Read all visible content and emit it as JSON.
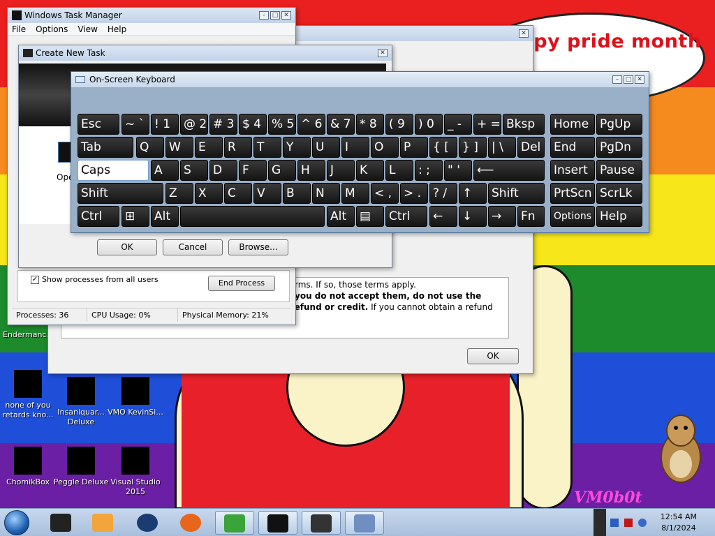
{
  "desktop": {
    "speech_text": "happy pride month",
    "watermark": "VM0b0t",
    "side_label_1": "Endermanc...",
    "icons": [
      {
        "label": "none of you retards kno..."
      },
      {
        "label": "Insaniquar... Deluxe"
      },
      {
        "label": "VMO KevinSi..."
      },
      {
        "label": "ChomikBox"
      },
      {
        "label": "Peggle Deluxe"
      },
      {
        "label": "Visual Studio 2015"
      }
    ]
  },
  "task_manager": {
    "title": "Windows Task Manager",
    "menu": [
      "File",
      "Options",
      "View",
      "Help"
    ],
    "show_all_label": "Show processes from all users",
    "end_process": "End Process",
    "status": {
      "processes": "Processes: 36",
      "cpu": "CPU Usage: 0%",
      "memory": "Physical Memory: 21%"
    }
  },
  "license_window": {
    "text_line1": "rms. If so, those terms apply.",
    "text_line2_bold": "you do not accept them, do not use the",
    "text_line3_bold": "software. Instead, return it to the retailer for a refund or credit.",
    "text_line3_tail": " If you cannot obtain a refund there,",
    "ok": "OK"
  },
  "create_task": {
    "title": "Create New Task",
    "open_label": "Ope",
    "ok": "OK",
    "cancel": "Cancel",
    "browse": "Browse..."
  },
  "osk": {
    "title": "On-Screen Keyboard",
    "rows": [
      [
        "Esc",
        "~ `",
        "! 1",
        "@ 2",
        "# 3",
        "$ 4",
        "% 5",
        "^ 6",
        "& 7",
        "* 8",
        "( 9",
        ") 0",
        "_ -",
        "+ =",
        "Bksp",
        "Home",
        "PgUp"
      ],
      [
        "Tab",
        "Q",
        "W",
        "E",
        "R",
        "T",
        "Y",
        "U",
        "I",
        "O",
        "P",
        "{ [",
        "} ]",
        "| \\",
        "Del",
        "End",
        "PgDn"
      ],
      [
        "Caps",
        "A",
        "S",
        "D",
        "F",
        "G",
        "H",
        "J",
        "K",
        "L",
        ": ;",
        "\" '",
        "⟵",
        "Insert",
        "Pause"
      ],
      [
        "Shift",
        "Z",
        "X",
        "C",
        "V",
        "B",
        "N",
        "M",
        "< ,",
        "> .",
        "? /",
        "↑",
        "Shift",
        "PrtScn",
        "ScrLk"
      ],
      [
        "Ctrl",
        "⊞",
        "Alt",
        "",
        "Alt",
        "▤",
        "Ctrl",
        "←",
        "↓",
        "→",
        "Fn",
        "Options",
        "Help"
      ]
    ]
  },
  "taskbar": {
    "time": "12:54 AM",
    "date": "8/1/2024"
  }
}
